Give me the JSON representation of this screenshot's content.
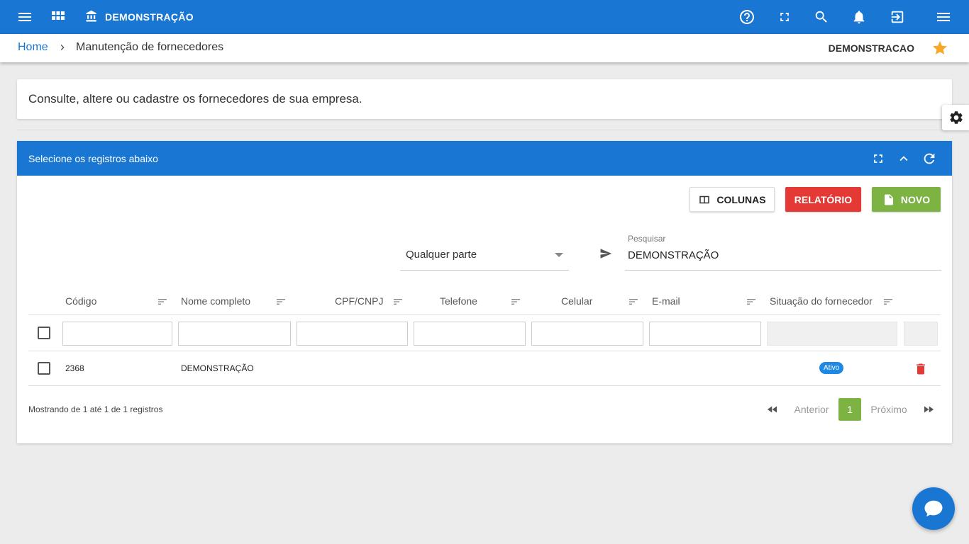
{
  "topbar": {
    "brand": "DEMONSTRAÇÃO",
    "icons": [
      "menu-icon",
      "apps-grid-icon",
      "bank-icon",
      "help-icon",
      "fullscreen-icon",
      "search-icon",
      "notifications-icon",
      "logout-icon",
      "menu-right-icon"
    ],
    "color": "#1976d2"
  },
  "breadcrumb": {
    "home": "Home",
    "current": "Manutenção de fornecedores",
    "company": "DEMONSTRACAO"
  },
  "info": {
    "text": "Consulte, altere ou cadastre os fornecedores de sua empresa."
  },
  "panel": {
    "title": "Selecione os registros abaixo",
    "buttons": {
      "colunas": "COLUNAS",
      "relatorio": "RELATÓRIO",
      "novo": "NOVO"
    },
    "filter_mode": "Qualquer parte",
    "search_label": "Pesquisar",
    "search_value": "DEMONSTRAÇÃO"
  },
  "table": {
    "columns": [
      "Código",
      "Nome completo",
      "CPF/CNPJ",
      "Telefone",
      "Celular",
      "E-mail",
      "Situação do fornecedor"
    ],
    "rows": [
      {
        "codigo": "2368",
        "nome": "DEMONSTRAÇÃO",
        "cpf": "",
        "telefone": "",
        "celular": "",
        "email": "",
        "situacao": "Ativo"
      }
    ]
  },
  "footer": {
    "info": "Mostrando de 1 até 1 de 1 registros",
    "prev": "Anterior",
    "page": "1",
    "next": "Próximo"
  },
  "colors": {
    "primary": "#1976d2",
    "danger": "#e53935",
    "success": "#7cb342",
    "star": "#f9a825"
  }
}
